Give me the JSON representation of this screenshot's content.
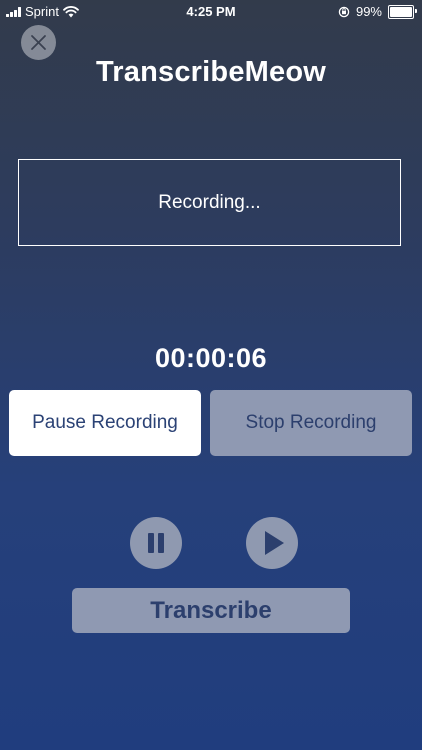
{
  "status_bar": {
    "carrier": "Sprint",
    "time": "4:25 PM",
    "battery_percent": "99%",
    "battery_level": 0.99,
    "icons": [
      "signal-icon",
      "wifi-icon",
      "orientation-lock-icon",
      "battery-icon"
    ]
  },
  "header": {
    "close_icon": "close-icon",
    "title": "TranscribeMeow"
  },
  "recording": {
    "status_text": "Recording...",
    "timer": "00:00:06"
  },
  "buttons": {
    "pause_label": "Pause Recording",
    "stop_label": "Stop Recording",
    "transcribe_label": "Transcribe",
    "pause_icon": "pause-icon",
    "play_icon": "play-icon"
  },
  "colors": {
    "primary_text": "#2b4275",
    "disabled_button": "#8f99b2",
    "background_top": "#323b4b",
    "background_bottom": "#203d7e"
  }
}
